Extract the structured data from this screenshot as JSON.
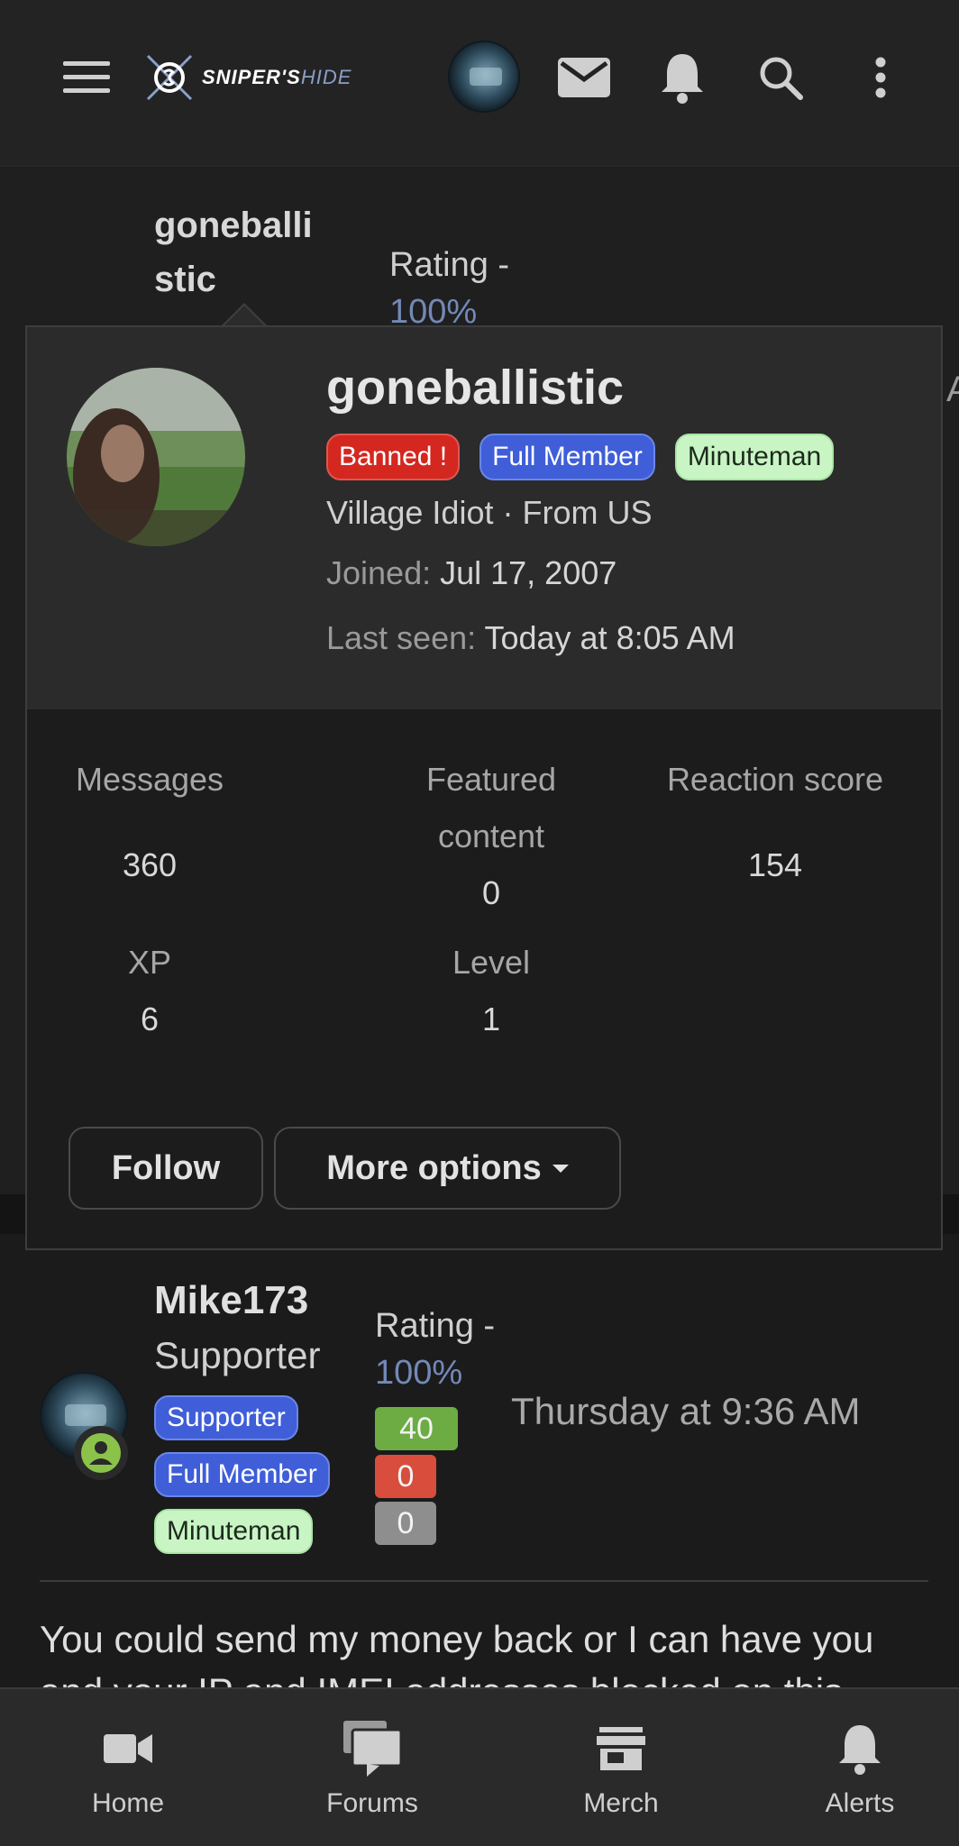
{
  "header": {
    "logo_main": "SNIPER'S",
    "logo_accent": "HIDE",
    "icons": [
      "menu-icon",
      "avatar",
      "mail-icon",
      "bell-icon",
      "search-icon",
      "more-vertical-icon"
    ]
  },
  "background": {
    "name_line1": "goneballi",
    "name_line2": "stic",
    "rating_label": "Rating -",
    "rating_pct": "100%",
    "cut_char": "A"
  },
  "popup": {
    "username": "goneballistic",
    "badges": [
      "Banned !",
      "Full Member",
      "Minuteman"
    ],
    "info": "Village Idiot · From US",
    "joined_label": "Joined:",
    "joined_value": "Jul 17, 2007",
    "seen_label": "Last seen:",
    "seen_value": "Today at 8:05 AM",
    "stats": {
      "messages_label": "Messages",
      "messages_value": "360",
      "featured_label_1": "Featured",
      "featured_label_2": "content",
      "featured_value": "0",
      "reaction_label": "Reaction score",
      "reaction_value": "154",
      "xp_label": "XP",
      "xp_value": "6",
      "level_label": "Level",
      "level_value": "1"
    },
    "follow_label": "Follow",
    "more_label": "More options"
  },
  "post": {
    "author": "Mike173",
    "title": "Supporter",
    "badges": [
      "Supporter",
      "Full Member",
      "Minuteman"
    ],
    "rating_label": "Rating -",
    "rating_pct": "100%",
    "score_positive": "40",
    "score_negative": "0",
    "score_neutral": "0",
    "time": "Thursday at 9:36 AM",
    "body": "You could send my money back or I can have you and your IP and IMEI addresses blocked on this"
  },
  "nav": {
    "home": "Home",
    "forums": "Forums",
    "merch": "Merch",
    "alerts": "Alerts"
  },
  "colors": {
    "background": "#1b1b1c",
    "banned": "#d3271f",
    "member": "#3f5ed8",
    "minuteman": "#c9f5c5",
    "rating_pct": "#7389b6"
  }
}
